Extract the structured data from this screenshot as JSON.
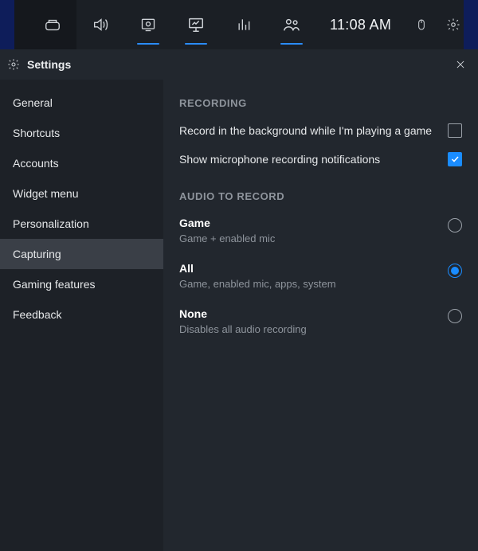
{
  "topbar": {
    "clock": "11:08 AM"
  },
  "panel": {
    "title": "Settings"
  },
  "sidebar": {
    "items": [
      {
        "label": "General"
      },
      {
        "label": "Shortcuts"
      },
      {
        "label": "Accounts"
      },
      {
        "label": "Widget menu"
      },
      {
        "label": "Personalization"
      },
      {
        "label": "Capturing"
      },
      {
        "label": "Gaming features"
      },
      {
        "label": "Feedback"
      }
    ],
    "active_index": 5
  },
  "content": {
    "recording": {
      "heading": "RECORDING",
      "background_label": "Record in the background while I'm playing a game",
      "background_checked": false,
      "mic_notif_label": "Show microphone recording notifications",
      "mic_notif_checked": true
    },
    "audio": {
      "heading": "AUDIO TO RECORD",
      "options": [
        {
          "title": "Game",
          "desc": "Game + enabled mic"
        },
        {
          "title": "All",
          "desc": "Game, enabled mic, apps, system"
        },
        {
          "title": "None",
          "desc": "Disables all audio recording"
        }
      ],
      "selected_index": 1
    }
  }
}
